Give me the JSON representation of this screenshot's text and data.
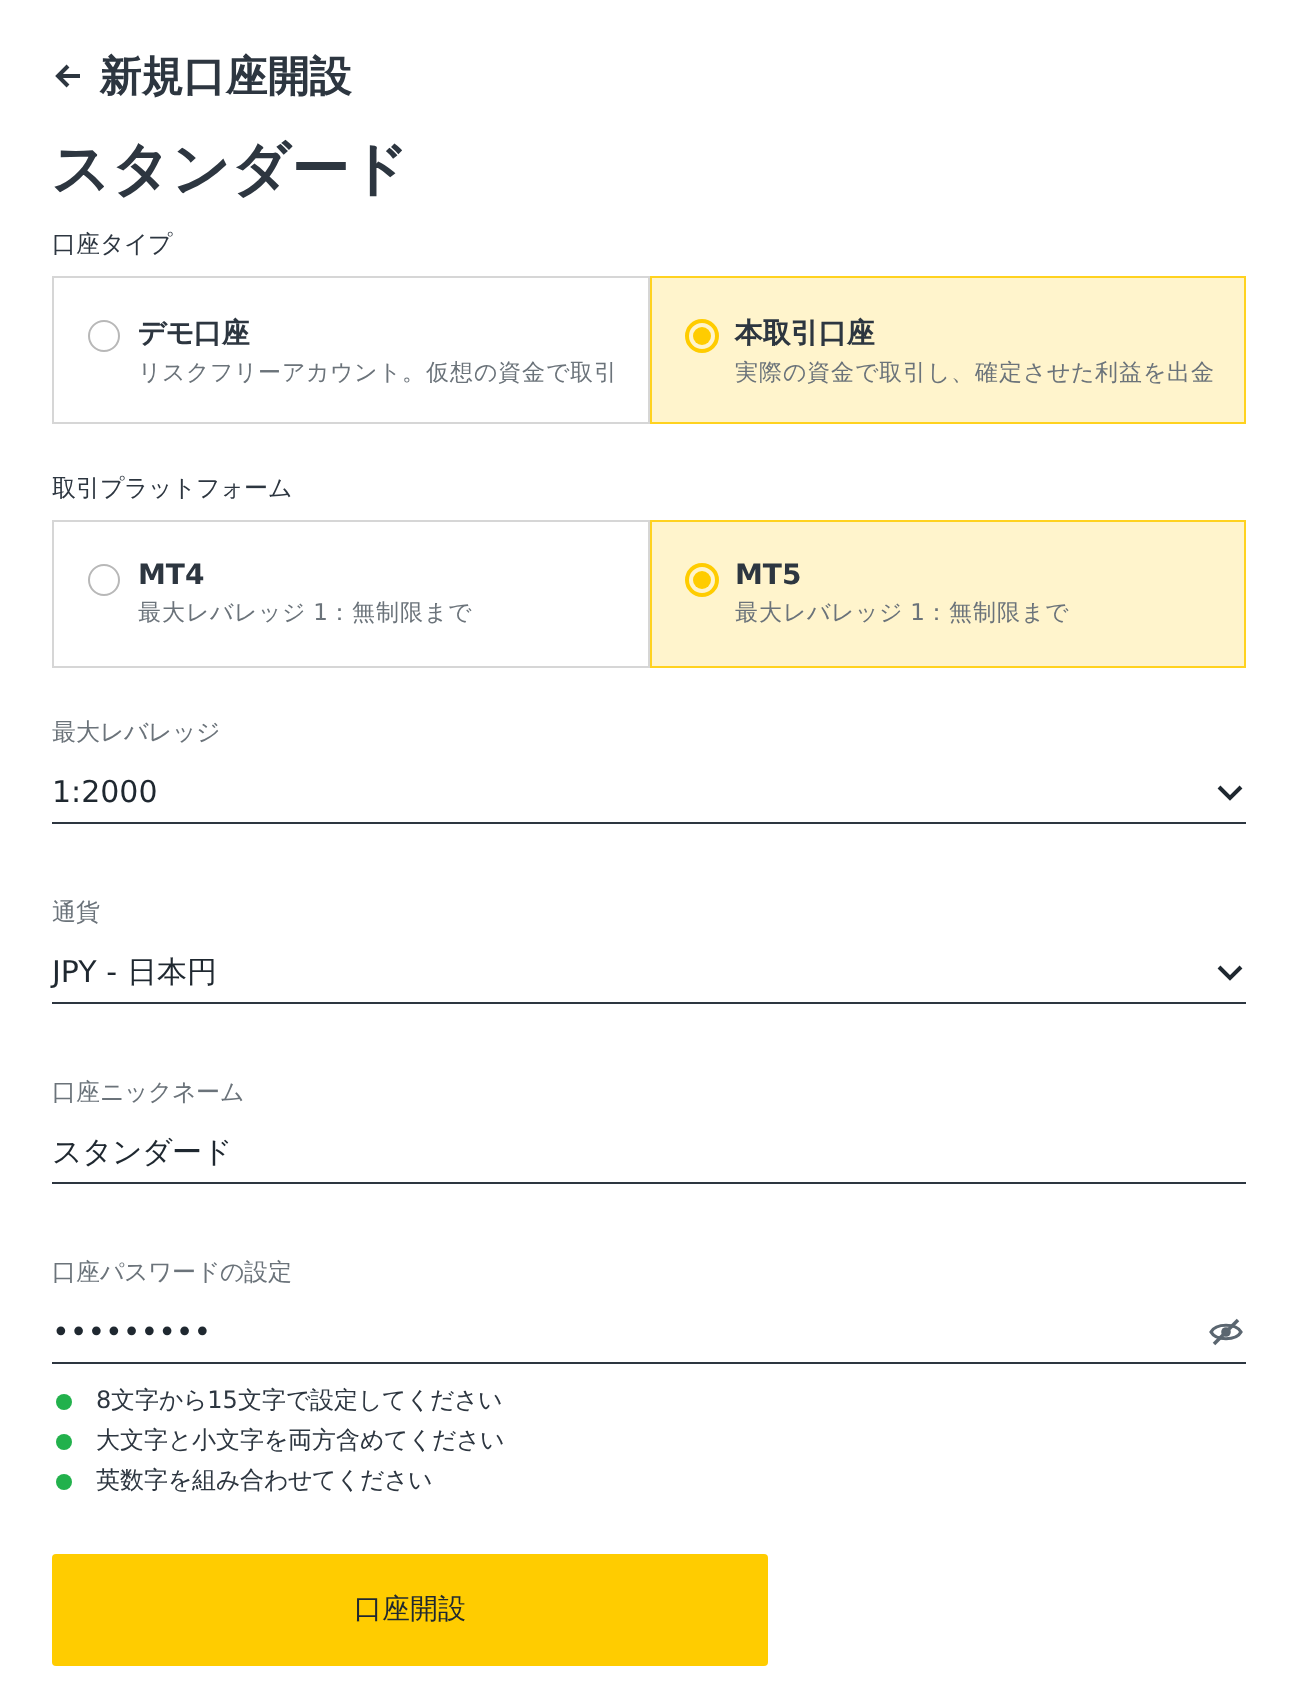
{
  "header": {
    "title": "新規口座開設"
  },
  "heading": "スタンダード",
  "option_groups": [
    {
      "label": "口座タイプ",
      "options": [
        {
          "title": "デモ口座",
          "description": "リスクフリーアカウント。仮想の資金で取引",
          "selected": false
        },
        {
          "title": "本取引口座",
          "description": "実際の資金で取引し、確定させた利益を出金",
          "selected": true
        }
      ]
    },
    {
      "label": "取引プラットフォーム",
      "options": [
        {
          "title": "MT4",
          "description": "最大レバレッジ 1：無制限まで",
          "selected": false
        },
        {
          "title": "MT5",
          "description": "最大レバレッジ 1：無制限まで",
          "selected": true
        }
      ]
    }
  ],
  "fields": [
    {
      "kind": "select",
      "label": "最大レバレッジ",
      "value": "1:2000"
    },
    {
      "kind": "select",
      "label": "通貨",
      "value": "JPY - 日本円"
    },
    {
      "kind": "text",
      "label": "口座ニックネーム",
      "value": "スタンダード"
    },
    {
      "kind": "password",
      "label": "口座パスワードの設定",
      "value": "•••••••••"
    }
  ],
  "password_rules": [
    {
      "text": "8文字から15文字で設定してください",
      "met": true
    },
    {
      "text": "大文字と小文字を両方含めてください",
      "met": true
    },
    {
      "text": "英数字を組み合わせてください",
      "met": true
    }
  ],
  "submit_button": "口座開設"
}
